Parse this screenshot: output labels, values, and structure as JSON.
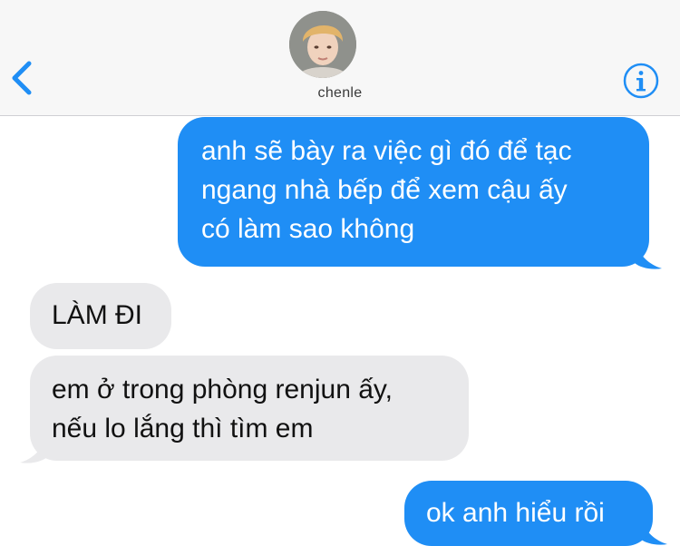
{
  "header": {
    "contact_name": "chenle",
    "back_icon": "chevron-left-icon",
    "info_icon": "info-circle-icon",
    "accent_color": "#1f8ef5"
  },
  "messages": [
    {
      "direction": "outgoing",
      "text": "anh sẽ bày ra việc gì đó để tạc\nngang nhà bếp để xem cậu ấy\ncó làm sao không"
    },
    {
      "direction": "incoming",
      "text": "LÀM ĐI"
    },
    {
      "direction": "incoming",
      "text": "em ở trong phòng renjun ấy,\nnếu lo lắng thì tìm em"
    },
    {
      "direction": "outgoing",
      "text": "ok anh hiểu rồi"
    }
  ],
  "colors": {
    "outgoing_bubble": "#1f8ef5",
    "incoming_bubble": "#e9e9eb",
    "header_background": "#f7f7f7"
  }
}
